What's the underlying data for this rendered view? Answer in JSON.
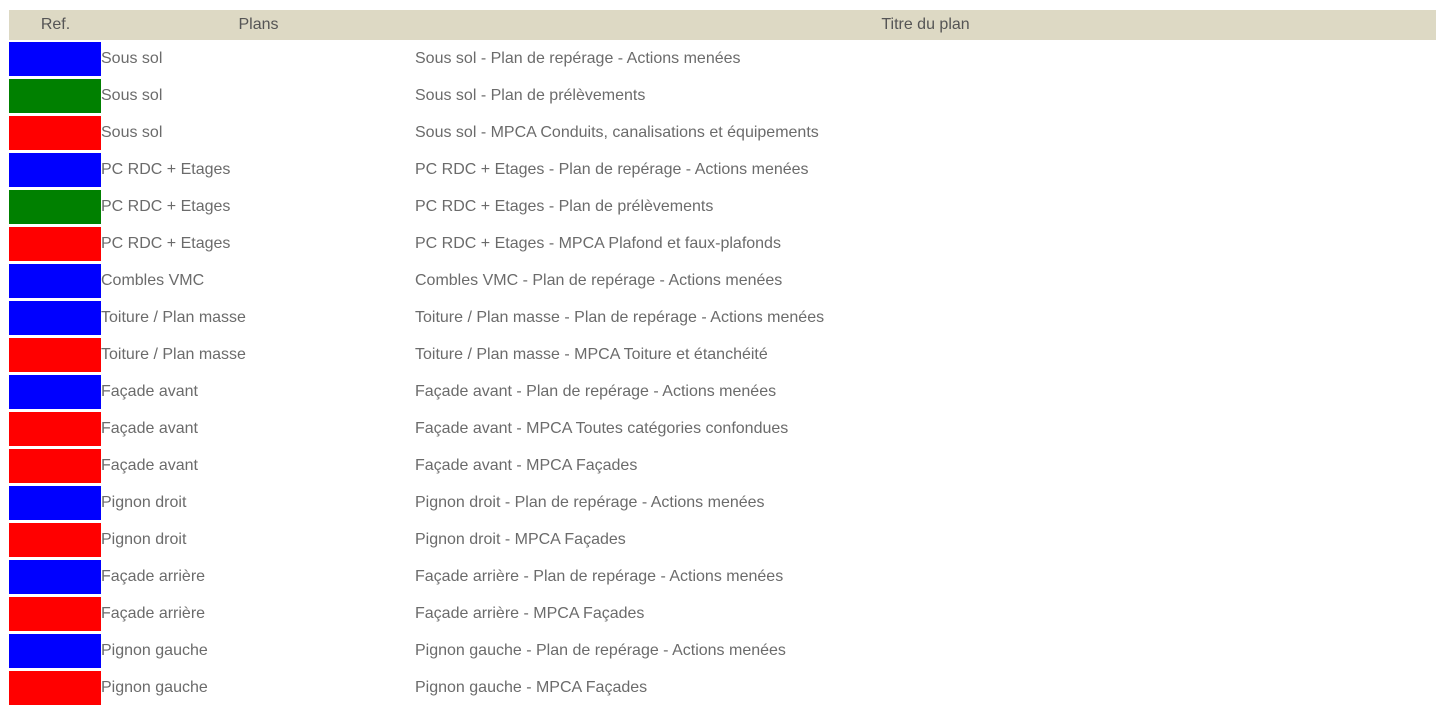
{
  "header": {
    "ref": "Ref.",
    "plans": "Plans",
    "titre": "Titre du plan"
  },
  "colors": {
    "blue": "#0000ff",
    "green": "#008000",
    "red": "#ff0000",
    "header_bg": "#ddd9c4"
  },
  "rows": [
    {
      "color": "#0000ff",
      "plan": "Sous sol",
      "titre": "Sous sol - Plan de repérage - Actions menées"
    },
    {
      "color": "#008000",
      "plan": "Sous sol",
      "titre": "Sous sol - Plan de prélèvements"
    },
    {
      "color": "#ff0000",
      "plan": "Sous sol",
      "titre": "Sous sol - MPCA Conduits, canalisations et équipements"
    },
    {
      "color": "#0000ff",
      "plan": "PC RDC + Etages",
      "titre": "PC RDC + Etages - Plan de repérage - Actions menées"
    },
    {
      "color": "#008000",
      "plan": "PC RDC + Etages",
      "titre": "PC RDC + Etages - Plan de prélèvements"
    },
    {
      "color": "#ff0000",
      "plan": "PC RDC + Etages",
      "titre": "PC RDC + Etages - MPCA Plafond et faux-plafonds"
    },
    {
      "color": "#0000ff",
      "plan": "Combles VMC",
      "titre": "Combles VMC - Plan de repérage - Actions menées"
    },
    {
      "color": "#0000ff",
      "plan": "Toiture / Plan masse",
      "titre": "Toiture / Plan masse - Plan de repérage - Actions menées"
    },
    {
      "color": "#ff0000",
      "plan": "Toiture / Plan masse",
      "titre": "Toiture / Plan masse - MPCA Toiture et étanchéité"
    },
    {
      "color": "#0000ff",
      "plan": "Façade avant",
      "titre": "Façade avant - Plan de repérage - Actions menées"
    },
    {
      "color": "#ff0000",
      "plan": "Façade avant",
      "titre": "Façade avant - MPCA Toutes catégories confondues"
    },
    {
      "color": "#ff0000",
      "plan": "Façade avant",
      "titre": "Façade avant - MPCA Façades"
    },
    {
      "color": "#0000ff",
      "plan": "Pignon droit",
      "titre": "Pignon droit - Plan de repérage - Actions menées"
    },
    {
      "color": "#ff0000",
      "plan": "Pignon droit",
      "titre": "Pignon droit - MPCA Façades"
    },
    {
      "color": "#0000ff",
      "plan": "Façade arrière",
      "titre": "Façade arrière - Plan de repérage - Actions menées"
    },
    {
      "color": "#ff0000",
      "plan": "Façade arrière",
      "titre": "Façade arrière - MPCA Façades"
    },
    {
      "color": "#0000ff",
      "plan": "Pignon gauche",
      "titre": "Pignon gauche - Plan de repérage - Actions menées"
    },
    {
      "color": "#ff0000",
      "plan": "Pignon gauche",
      "titre": "Pignon gauche - MPCA Façades"
    }
  ]
}
